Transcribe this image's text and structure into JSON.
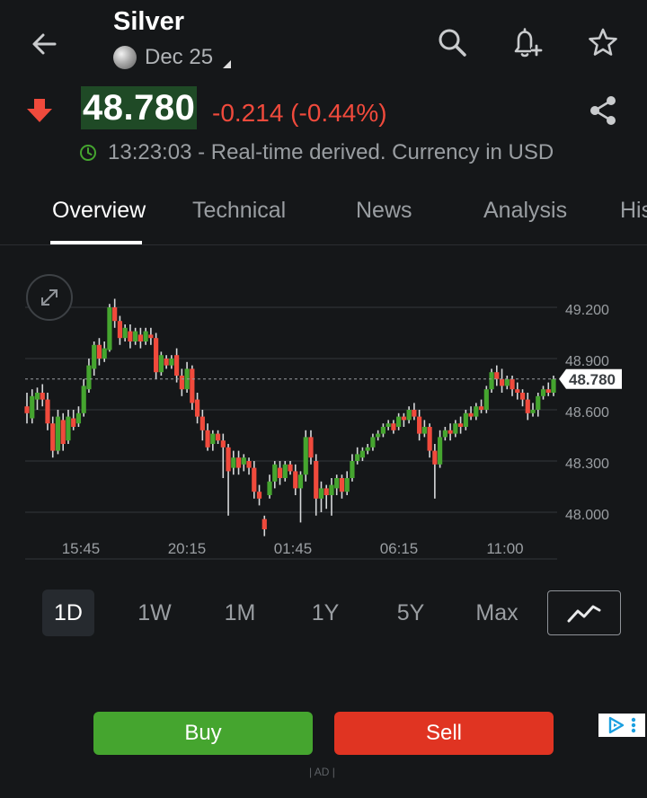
{
  "header": {
    "title": "Silver",
    "contract": "Dec 25",
    "icons": [
      "back-arrow-icon",
      "search-icon",
      "add-alert-icon",
      "star-icon"
    ]
  },
  "quote": {
    "price": "48.780",
    "change": "-0.214 (-0.44%)",
    "direction": "down",
    "time_info": "13:23:03 - Real-time derived. Currency in USD",
    "colors": {
      "down": "#f04a3c",
      "up": "#45a52f",
      "price_bg": "#1f4a26"
    }
  },
  "tabs": [
    {
      "label": "Overview",
      "active": true
    },
    {
      "label": "Technical",
      "active": false
    },
    {
      "label": "News",
      "active": false
    },
    {
      "label": "Analysis",
      "active": false
    },
    {
      "label": "His",
      "active": false
    }
  ],
  "chart_data": {
    "type": "candlestick",
    "y_ticks": [
      "49.200",
      "48.900",
      "48.600",
      "48.300",
      "48.000"
    ],
    "y_range": [
      47.85,
      49.3
    ],
    "x_ticks": [
      "15:45",
      "20:15",
      "01:45",
      "06:15",
      "11:00"
    ],
    "current_price_label": "48.780",
    "current_price": 48.78,
    "candles": [
      [
        48.62,
        48.58,
        48.7,
        48.52
      ],
      [
        48.55,
        48.68,
        48.72,
        48.52
      ],
      [
        48.66,
        48.7,
        48.73,
        48.6
      ],
      [
        48.7,
        48.66,
        48.75,
        48.62
      ],
      [
        48.66,
        48.52,
        48.7,
        48.48
      ],
      [
        48.52,
        48.36,
        48.56,
        48.32
      ],
      [
        48.36,
        48.56,
        48.6,
        48.34
      ],
      [
        48.54,
        48.4,
        48.58,
        48.36
      ],
      [
        48.42,
        48.56,
        48.6,
        48.4
      ],
      [
        48.55,
        48.5,
        48.6,
        48.48
      ],
      [
        48.52,
        48.58,
        48.62,
        48.5
      ],
      [
        48.58,
        48.74,
        48.78,
        48.56
      ],
      [
        48.72,
        48.86,
        48.9,
        48.7
      ],
      [
        48.84,
        48.98,
        49.0,
        48.8
      ],
      [
        48.98,
        48.9,
        49.02,
        48.86
      ],
      [
        48.9,
        48.96,
        49.0,
        48.88
      ],
      [
        48.95,
        49.2,
        49.22,
        48.94
      ],
      [
        49.2,
        49.12,
        49.25,
        49.08
      ],
      [
        49.12,
        49.02,
        49.15,
        48.98
      ],
      [
        49.02,
        49.08,
        49.1,
        49.0
      ],
      [
        49.06,
        49.0,
        49.1,
        48.96
      ],
      [
        49.0,
        49.06,
        49.08,
        48.98
      ],
      [
        49.04,
        49.0,
        49.08,
        48.96
      ],
      [
        49.0,
        49.06,
        49.08,
        48.98
      ],
      [
        49.04,
        49.02,
        49.08,
        48.98
      ],
      [
        49.02,
        48.82,
        49.05,
        48.78
      ],
      [
        48.82,
        48.92,
        48.94,
        48.8
      ],
      [
        48.9,
        48.86,
        48.92,
        48.84
      ],
      [
        48.86,
        48.9,
        48.92,
        48.84
      ],
      [
        48.92,
        48.8,
        48.96,
        48.76
      ],
      [
        48.8,
        48.72,
        48.84,
        48.68
      ],
      [
        48.72,
        48.84,
        48.88,
        48.7
      ],
      [
        48.84,
        48.64,
        48.86,
        48.6
      ],
      [
        48.66,
        48.56,
        48.7,
        48.52
      ],
      [
        48.56,
        48.48,
        48.6,
        48.42
      ],
      [
        48.48,
        48.38,
        48.52,
        48.36
      ],
      [
        48.4,
        48.46,
        48.48,
        48.36
      ],
      [
        48.46,
        48.42,
        48.48,
        48.4
      ],
      [
        48.42,
        48.38,
        48.46,
        48.2
      ],
      [
        48.38,
        48.24,
        48.4,
        47.98
      ],
      [
        48.26,
        48.32,
        48.36,
        48.22
      ],
      [
        48.32,
        48.26,
        48.36,
        48.22
      ],
      [
        48.28,
        48.32,
        48.34,
        48.24
      ],
      [
        48.3,
        48.26,
        48.32,
        48.22
      ],
      [
        48.26,
        48.12,
        48.3,
        48.08
      ],
      [
        48.12,
        48.08,
        48.16,
        48.04
      ],
      [
        47.96,
        47.9,
        47.98,
        47.86
      ],
      [
        48.1,
        48.18,
        48.22,
        48.08
      ],
      [
        48.18,
        48.28,
        48.3,
        48.14
      ],
      [
        48.26,
        48.2,
        48.3,
        48.16
      ],
      [
        48.2,
        48.28,
        48.3,
        48.18
      ],
      [
        48.28,
        48.24,
        48.3,
        48.22
      ],
      [
        48.24,
        48.14,
        48.28,
        48.1
      ],
      [
        48.14,
        48.22,
        48.24,
        47.94
      ],
      [
        48.22,
        48.44,
        48.48,
        48.18
      ],
      [
        48.44,
        48.32,
        48.48,
        48.28
      ],
      [
        48.3,
        48.08,
        48.34,
        47.98
      ],
      [
        48.08,
        48.14,
        48.18,
        48.0
      ],
      [
        48.14,
        48.1,
        48.16,
        48.02
      ],
      [
        48.1,
        48.16,
        48.2,
        47.98
      ],
      [
        48.14,
        48.2,
        48.22,
        48.1
      ],
      [
        48.2,
        48.12,
        48.22,
        48.08
      ],
      [
        48.12,
        48.2,
        48.24,
        48.1
      ],
      [
        48.2,
        48.3,
        48.34,
        48.18
      ],
      [
        48.3,
        48.34,
        48.38,
        48.28
      ],
      [
        48.32,
        48.36,
        48.38,
        48.3
      ],
      [
        48.36,
        48.38,
        48.4,
        48.34
      ],
      [
        48.38,
        48.44,
        48.46,
        48.36
      ],
      [
        48.44,
        48.46,
        48.48,
        48.42
      ],
      [
        48.46,
        48.5,
        48.52,
        48.44
      ],
      [
        48.5,
        48.52,
        48.54,
        48.48
      ],
      [
        48.52,
        48.48,
        48.54,
        48.46
      ],
      [
        48.5,
        48.56,
        48.58,
        48.48
      ],
      [
        48.56,
        48.54,
        48.58,
        48.5
      ],
      [
        48.54,
        48.6,
        48.62,
        48.52
      ],
      [
        48.6,
        48.56,
        48.64,
        48.54
      ],
      [
        48.56,
        48.46,
        48.6,
        48.42
      ],
      [
        48.46,
        48.5,
        48.54,
        48.44
      ],
      [
        48.5,
        48.36,
        48.52,
        48.32
      ],
      [
        48.36,
        48.28,
        48.4,
        48.08
      ],
      [
        48.28,
        48.44,
        48.48,
        48.26
      ],
      [
        48.44,
        48.48,
        48.5,
        48.42
      ],
      [
        48.48,
        48.46,
        48.52,
        48.42
      ],
      [
        48.46,
        48.52,
        48.54,
        48.44
      ],
      [
        48.52,
        48.5,
        48.56,
        48.46
      ],
      [
        48.5,
        48.58,
        48.6,
        48.48
      ],
      [
        48.58,
        48.56,
        48.62,
        48.54
      ],
      [
        48.56,
        48.62,
        48.64,
        48.54
      ],
      [
        48.62,
        48.6,
        48.66,
        48.58
      ],
      [
        48.6,
        48.72,
        48.74,
        48.58
      ],
      [
        48.72,
        48.82,
        48.84,
        48.7
      ],
      [
        48.82,
        48.78,
        48.86,
        48.74
      ],
      [
        48.78,
        48.74,
        48.84,
        48.7
      ],
      [
        48.74,
        48.78,
        48.8,
        48.72
      ],
      [
        48.78,
        48.72,
        48.8,
        48.68
      ],
      [
        48.72,
        48.7,
        48.76,
        48.66
      ],
      [
        48.7,
        48.66,
        48.72,
        48.62
      ],
      [
        48.66,
        48.58,
        48.7,
        48.54
      ],
      [
        48.58,
        48.6,
        48.64,
        48.56
      ],
      [
        48.6,
        48.68,
        48.7,
        48.56
      ],
      [
        48.68,
        48.72,
        48.74,
        48.66
      ],
      [
        48.72,
        48.7,
        48.76,
        48.68
      ],
      [
        48.7,
        48.78,
        48.8,
        48.68
      ]
    ]
  },
  "ranges": [
    {
      "label": "1D",
      "active": true
    },
    {
      "label": "1W",
      "active": false
    },
    {
      "label": "1M",
      "active": false
    },
    {
      "label": "1Y",
      "active": false
    },
    {
      "label": "5Y",
      "active": false
    },
    {
      "label": "Max",
      "active": false
    }
  ],
  "actions": {
    "buy": "Buy",
    "sell": "Sell",
    "ad_label": "| AD |"
  }
}
